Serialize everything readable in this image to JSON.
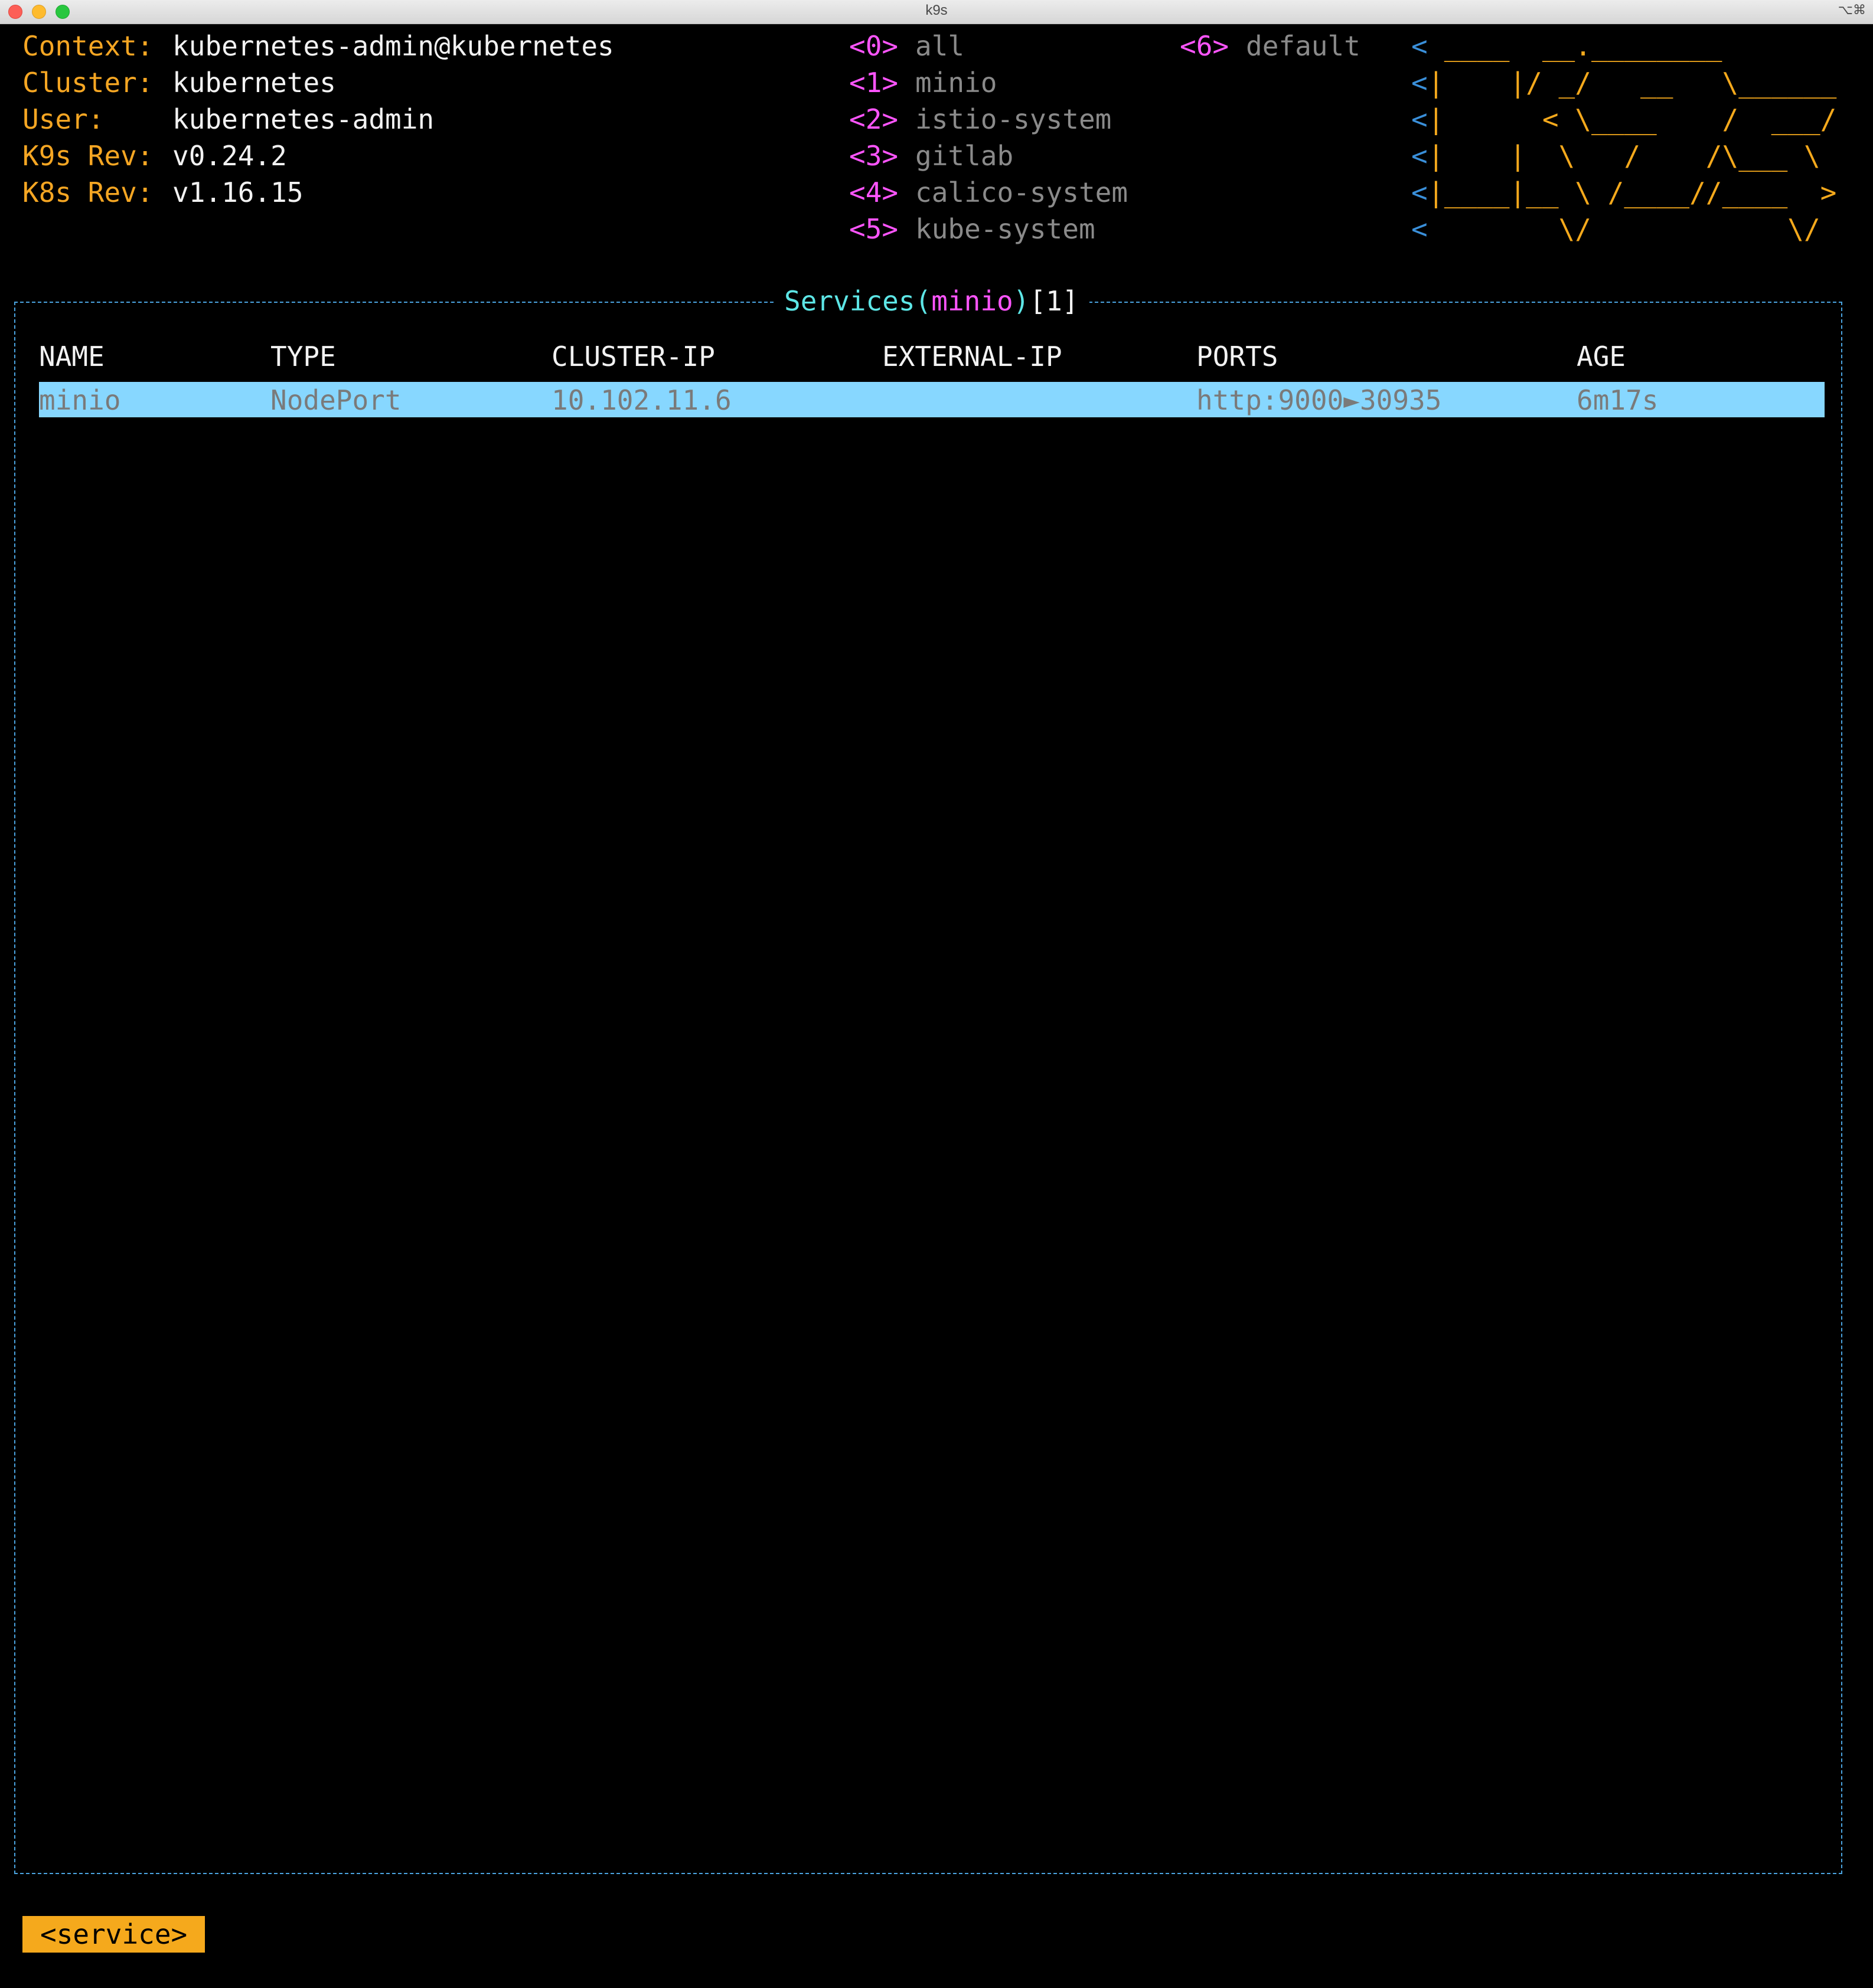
{
  "window": {
    "title": "k9s",
    "shortcut": "⌥⌘"
  },
  "cluster_info": [
    {
      "label": "Context:",
      "value": "kubernetes-admin@kubernetes"
    },
    {
      "label": "Cluster:",
      "value": "kubernetes"
    },
    {
      "label": "User:",
      "value": "kubernetes-admin"
    },
    {
      "label": "K9s Rev:",
      "value": "v0.24.2"
    },
    {
      "label": "K8s Rev:",
      "value": "v1.16.15"
    }
  ],
  "namespaces": [
    {
      "key": "<0>",
      "name": "all"
    },
    {
      "key": "<1>",
      "name": "minio"
    },
    {
      "key": "<2>",
      "name": "istio-system"
    },
    {
      "key": "<3>",
      "name": "gitlab"
    },
    {
      "key": "<4>",
      "name": "calico-system"
    },
    {
      "key": "<5>",
      "name": "kube-system"
    },
    {
      "key": "<6>",
      "name": "default"
    }
  ],
  "logo": {
    "lines": [
      " ____  __.________",
      "|    |/ _/   __   \\______",
      "|      < \\____    /  ___/",
      "|    |  \\   /    /\\___ \\",
      "|____|__ \\ /____//____  >",
      "        \\/            \\/"
    ],
    "prefix_lines": [
      "<",
      "<",
      "<",
      "<",
      "<",
      "<"
    ]
  },
  "panel": {
    "resource": "Services",
    "open_paren": "(",
    "namespace": "minio",
    "close_paren": ")",
    "count": "[1]"
  },
  "table": {
    "columns": [
      "NAME",
      "TYPE",
      "CLUSTER-IP",
      "EXTERNAL-IP",
      "PORTS",
      "AGE"
    ],
    "rows": [
      {
        "name": "minio",
        "type": "NodePort",
        "cluster_ip": "10.102.11.6",
        "external_ip": "",
        "ports": "http:9000►30935",
        "age": "6m17s"
      }
    ]
  },
  "breadcrumb": "<service>"
}
